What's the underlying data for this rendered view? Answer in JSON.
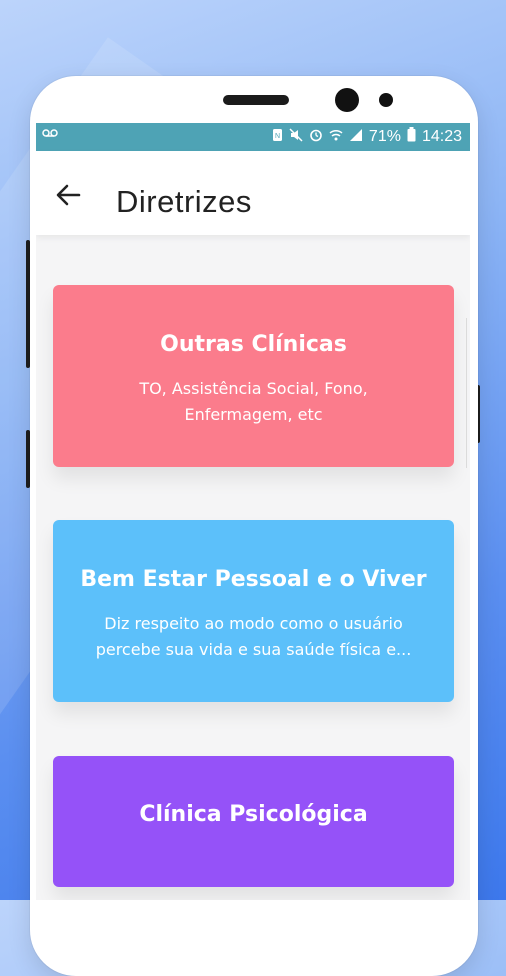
{
  "status_bar": {
    "left_icon": "voicemail-icon",
    "battery": "71%",
    "time": "14:23"
  },
  "header": {
    "back_icon": "arrow-back-icon",
    "title": "Diretrizes"
  },
  "cards": [
    {
      "title": "Outras Clínicas",
      "description": "TO, Assistência Social, Fono, Enfermagem, etc",
      "color": "#fb7c8c"
    },
    {
      "title": "Bem Estar Pessoal e o Viver",
      "description": "Diz respeito ao modo como o usuário percebe sua vida e sua saúde física e...",
      "color": "#5cc0fa"
    },
    {
      "title": "Clínica Psicológica",
      "description": "",
      "color": "#9552f8"
    }
  ],
  "colors": {
    "status_bar": "#4ea3b5",
    "background_gradient_start": "#bcd4fb",
    "background_gradient_end": "#3d78ec"
  }
}
